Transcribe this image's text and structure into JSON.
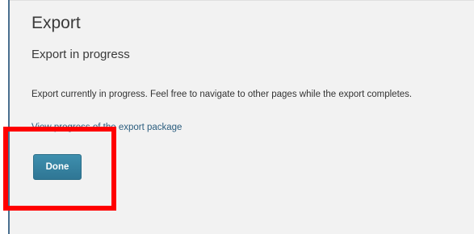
{
  "dialog": {
    "title": "Export",
    "subtitle": "Export in progress",
    "message": "Export currently in progress. Feel free to navigate to other pages while the export completes.",
    "progress_link": "View progress of the export package",
    "done_label": "Done"
  },
  "colors": {
    "panel_background": "#f2f2f2",
    "link": "#2b5d7e",
    "button": "#3581a0",
    "highlight": "#ff0000"
  }
}
